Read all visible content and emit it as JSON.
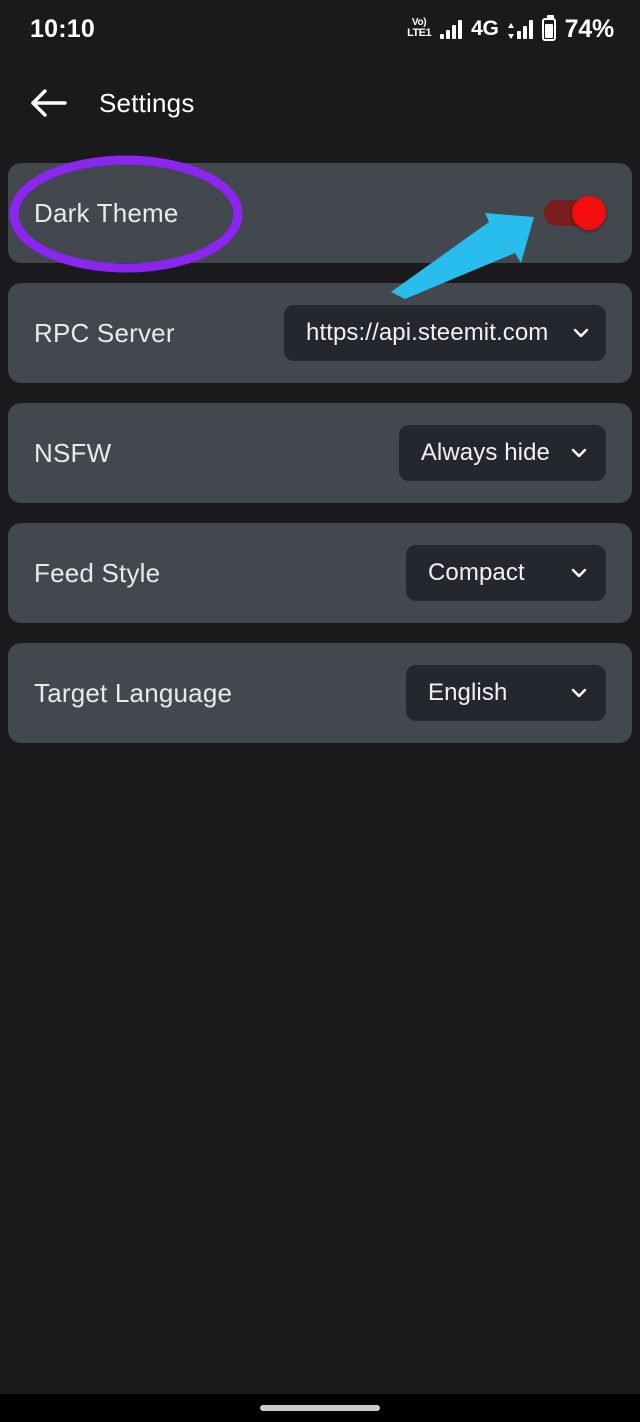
{
  "status_bar": {
    "clock": "10:10",
    "volte_top": "Vo)",
    "volte_bottom": "LTE1",
    "network_label": "4G",
    "battery_percent": "74%",
    "icons": [
      "volte-icon",
      "signal-bars-icon",
      "network-type-label",
      "signal-bars-data-icon",
      "battery-icon"
    ]
  },
  "app_bar": {
    "back_icon": "back-arrow-icon",
    "title": "Settings"
  },
  "settings": {
    "rows": [
      {
        "key": "dark-theme",
        "label": "Dark Theme",
        "control": "toggle",
        "toggle_on": true
      },
      {
        "key": "rpc",
        "label": "RPC Server",
        "control": "dropdown",
        "value": "https://api.steemit.com"
      },
      {
        "key": "nsfw",
        "label": "NSFW",
        "control": "dropdown",
        "value": "Always hide"
      },
      {
        "key": "feed-style",
        "label": "Feed Style",
        "control": "dropdown",
        "value": "Compact"
      },
      {
        "key": "target-language",
        "label": "Target Language",
        "control": "dropdown",
        "value": "English"
      }
    ]
  },
  "annotations": {
    "ellipse": {
      "name": "highlight-ellipse",
      "target": "Dark Theme",
      "color": "#8b25f0"
    },
    "arrow": {
      "name": "pointer-arrow",
      "target": "dark-theme-toggle",
      "color": "#29bdee"
    }
  },
  "colors": {
    "page_background": "#1a1a1c",
    "card_background": "#43474e",
    "dropdown_background": "#24282e",
    "text_primary": "#e9eaec",
    "toggle_thumb": "#f40d0d",
    "toggle_track": "#7a1d1d",
    "annotation_purple": "#8b25f0",
    "annotation_cyan": "#29bdee"
  },
  "system": {
    "gesture_pill": "home-gesture-pill"
  }
}
